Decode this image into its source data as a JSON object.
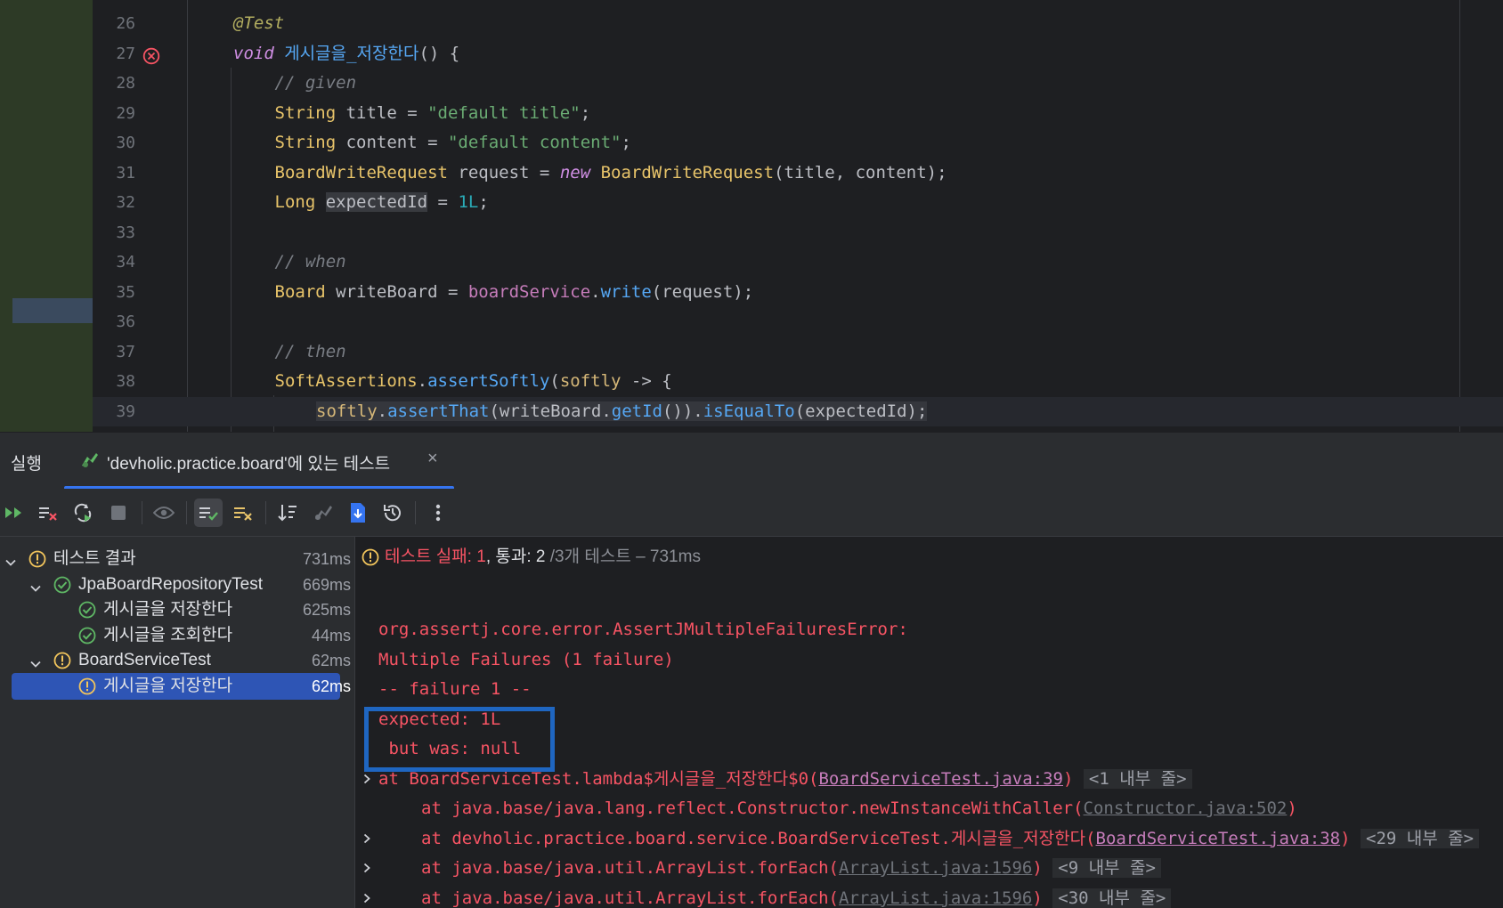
{
  "editor": {
    "lines": [
      {
        "num": "26",
        "segments": [
          {
            "t": "@Test",
            "c": "tk-ann"
          }
        ]
      },
      {
        "num": "27",
        "error": true,
        "segments": [
          {
            "t": "void ",
            "c": "tk-kw"
          },
          {
            "t": "게시글을_저장한다",
            "c": "tk-mname"
          },
          {
            "t": "() {",
            "c": "tk-plain"
          }
        ]
      },
      {
        "num": "28",
        "segments": [
          {
            "t": "// given",
            "c": "tk-cmt"
          }
        ]
      },
      {
        "num": "29",
        "segments": [
          {
            "t": "String",
            "c": "tk-type"
          },
          {
            "t": " title = ",
            "c": "tk-plain"
          },
          {
            "t": "\"default title\"",
            "c": "tk-str"
          },
          {
            "t": ";",
            "c": "tk-plain"
          }
        ]
      },
      {
        "num": "30",
        "segments": [
          {
            "t": "String",
            "c": "tk-type"
          },
          {
            "t": " content = ",
            "c": "tk-plain"
          },
          {
            "t": "\"default content\"",
            "c": "tk-str"
          },
          {
            "t": ";",
            "c": "tk-plain"
          }
        ]
      },
      {
        "num": "31",
        "segments": [
          {
            "t": "BoardWriteRequest",
            "c": "tk-type"
          },
          {
            "t": " request = ",
            "c": "tk-plain"
          },
          {
            "t": "new",
            "c": "tk-kw"
          },
          {
            "t": " ",
            "c": "tk-plain"
          },
          {
            "t": "BoardWriteRequest",
            "c": "tk-type"
          },
          {
            "t": "(title, content);",
            "c": "tk-plain"
          }
        ]
      },
      {
        "num": "32",
        "segments": [
          {
            "t": "Long",
            "c": "tk-type"
          },
          {
            "t": " ",
            "c": "tk-plain"
          },
          {
            "t": "expectedId",
            "c": "tk-plain hl-var"
          },
          {
            "t": " = ",
            "c": "tk-plain"
          },
          {
            "t": "1L",
            "c": "tk-num"
          },
          {
            "t": ";",
            "c": "tk-plain"
          }
        ]
      },
      {
        "num": "33",
        "segments": []
      },
      {
        "num": "34",
        "segments": [
          {
            "t": "// when",
            "c": "tk-cmt"
          }
        ]
      },
      {
        "num": "35",
        "segments": [
          {
            "t": "Board",
            "c": "tk-type"
          },
          {
            "t": " writeBoard = ",
            "c": "tk-plain"
          },
          {
            "t": "boardService",
            "c": "tk-field"
          },
          {
            "t": ".",
            "c": "tk-plain"
          },
          {
            "t": "write",
            "c": "tk-call"
          },
          {
            "t": "(request);",
            "c": "tk-plain"
          }
        ]
      },
      {
        "num": "36",
        "segments": []
      },
      {
        "num": "37",
        "segments": [
          {
            "t": "// then",
            "c": "tk-cmt"
          }
        ]
      },
      {
        "num": "38",
        "segments": [
          {
            "t": "SoftAssertions",
            "c": "tk-type"
          },
          {
            "t": ".",
            "c": "tk-plain"
          },
          {
            "t": "assertSoftly",
            "c": "tk-call"
          },
          {
            "t": "(",
            "c": "tk-plain"
          },
          {
            "t": "softly",
            "c": "tk-param"
          },
          {
            "t": " -> {",
            "c": "tk-plain"
          }
        ]
      },
      {
        "num": "39",
        "current": true,
        "segments": [
          {
            "t": "softly",
            "c": "tk-param hl-stmt"
          },
          {
            "t": ".",
            "c": "tk-plain hl-stmt"
          },
          {
            "t": "assertThat",
            "c": "tk-call hl-stmt"
          },
          {
            "t": "(writeBoard.",
            "c": "tk-plain hl-stmt"
          },
          {
            "t": "getId",
            "c": "tk-call hl-stmt"
          },
          {
            "t": "()).",
            "c": "tk-plain hl-stmt"
          },
          {
            "t": "isEqualTo",
            "c": "tk-call hl-stmt"
          },
          {
            "t": "(expectedId);",
            "c": "tk-plain hl-stmt"
          }
        ]
      }
    ]
  },
  "toolwindow": {
    "title": "실행",
    "tab_label": "'devholic.practice.board'에 있는 테스트",
    "tab_close": "×"
  },
  "toolbar": {
    "buttons": [
      "rerun-tests",
      "rerun-failed",
      "toggle-auto-test",
      "stop",
      "show-passed",
      "show-ignored",
      "sort",
      "test-history-tree",
      "import-tests",
      "export-results",
      "run-history",
      "more-options"
    ]
  },
  "tree": {
    "rows": [
      {
        "label": "테스트 결과",
        "time": "731ms",
        "status": "warning",
        "level": 0,
        "expanded": true
      },
      {
        "label": "JpaBoardRepositoryTest",
        "time": "669ms",
        "status": "passed",
        "level": 1,
        "expanded": true
      },
      {
        "label": "게시글을 저장한다",
        "time": "625ms",
        "status": "passed",
        "level": 2
      },
      {
        "label": "게시글을 조회한다",
        "time": "44ms",
        "status": "passed",
        "level": 2
      },
      {
        "label": "BoardServiceTest",
        "time": "62ms",
        "status": "warning",
        "level": 1,
        "expanded": true
      },
      {
        "label": "게시글을 저장한다",
        "time": "62ms",
        "status": "warning",
        "level": 2,
        "selected": true
      }
    ]
  },
  "console": {
    "status": {
      "failed": "테스트 실패: 1",
      "passed": "통과: 2",
      "rest": "/3개 테스트 – 731ms"
    },
    "lines": [
      {
        "text": "org.assertj.core.error.AssertJMultipleFailuresError:"
      },
      {
        "text": "Multiple Failures (1 failure)"
      },
      {
        "text": "-- failure 1 --"
      },
      {
        "text": "expected: 1L"
      },
      {
        "text": " but was: null"
      }
    ],
    "trace": [
      {
        "pre": "at BoardServiceTest.lambda$게시글을_저장한다$0(",
        "link": "BoardServiceTest.java:39",
        "link_style": "lnk",
        "post": ")",
        "fold": "<1 내부 줄>",
        "expand": true,
        "indent": false
      },
      {
        "pre": "at java.base/java.lang.reflect.Constructor.newInstanceWithCaller(",
        "link": "Constructor.java:502",
        "link_style": "lnk-gray",
        "post": ")",
        "fold": "",
        "expand": false,
        "indent": true
      },
      {
        "pre": "at devholic.practice.board.service.BoardServiceTest.게시글을_저장한다(",
        "link": "BoardServiceTest.java:38",
        "link_style": "lnk",
        "post": ")",
        "fold": "<29 내부 줄>",
        "expand": true,
        "indent": true
      },
      {
        "pre": "at java.base/java.util.ArrayList.forEach(",
        "link": "ArrayList.java:1596",
        "link_style": "lnk-gray",
        "post": ")",
        "fold": "<9 내부 줄>",
        "expand": true,
        "indent": true
      },
      {
        "pre": "at java.base/java.util.ArrayList.forEach(",
        "link": "ArrayList.java:1596",
        "link_style": "lnk-gray",
        "post": ")",
        "fold": "<30 내부 줄>",
        "expand": true,
        "indent": true
      }
    ]
  },
  "colors": {
    "accent": "#3574f0",
    "error": "#f75464",
    "passed": "#5fb865",
    "warning": "#f2c55c",
    "highlight_box": "#1f66c1"
  }
}
